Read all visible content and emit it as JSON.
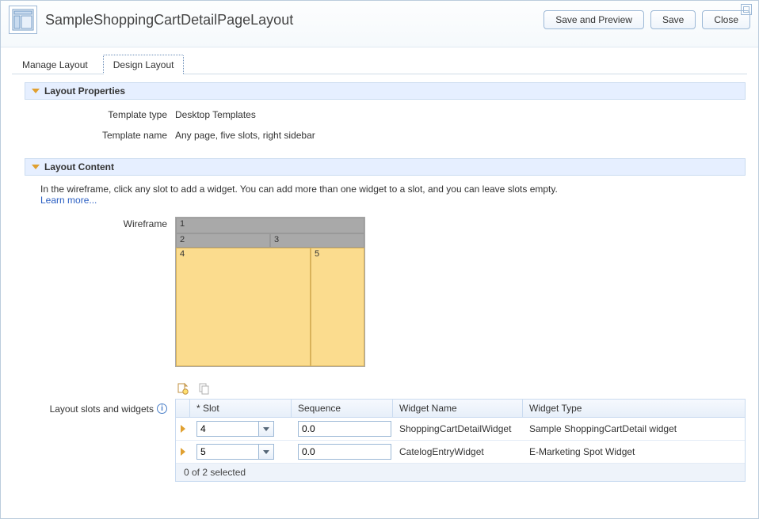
{
  "header": {
    "title": "SampleShoppingCartDetailPageLayout",
    "buttons": {
      "save_preview": "Save and Preview",
      "save": "Save",
      "close": "Close"
    }
  },
  "tabs": {
    "manage": "Manage Layout",
    "design": "Design Layout",
    "active": "design"
  },
  "sections": {
    "properties_title": "Layout Properties",
    "content_title": "Layout Content"
  },
  "properties": {
    "template_type_label": "Template type",
    "template_type_value": "Desktop Templates",
    "template_name_label": "Template name",
    "template_name_value": "Any page, five slots, right sidebar"
  },
  "content_section": {
    "instruction": "In the wireframe, click any slot to add a widget. You can add more than one widget to a slot, and you can leave slots empty.",
    "learn_more": "Learn more...",
    "wireframe_label": "Wireframe",
    "slots_label": "Layout slots and widgets"
  },
  "wireframe": {
    "slot1": "1",
    "slot2": "2",
    "slot3": "3",
    "slot4": "4",
    "slot5": "5"
  },
  "table": {
    "headers": {
      "slot": "* Slot",
      "sequence": "Sequence",
      "widget_name": "Widget Name",
      "widget_type": "Widget Type"
    },
    "rows": [
      {
        "slot": "4",
        "sequence": "0.0",
        "widget_name": "ShoppingCartDetailWidget",
        "widget_type": "Sample ShoppingCartDetail widget"
      },
      {
        "slot": "5",
        "sequence": "0.0",
        "widget_name": "CatelogEntryWidget",
        "widget_type": "E-Marketing Spot Widget"
      }
    ],
    "footer": "0 of 2 selected"
  }
}
